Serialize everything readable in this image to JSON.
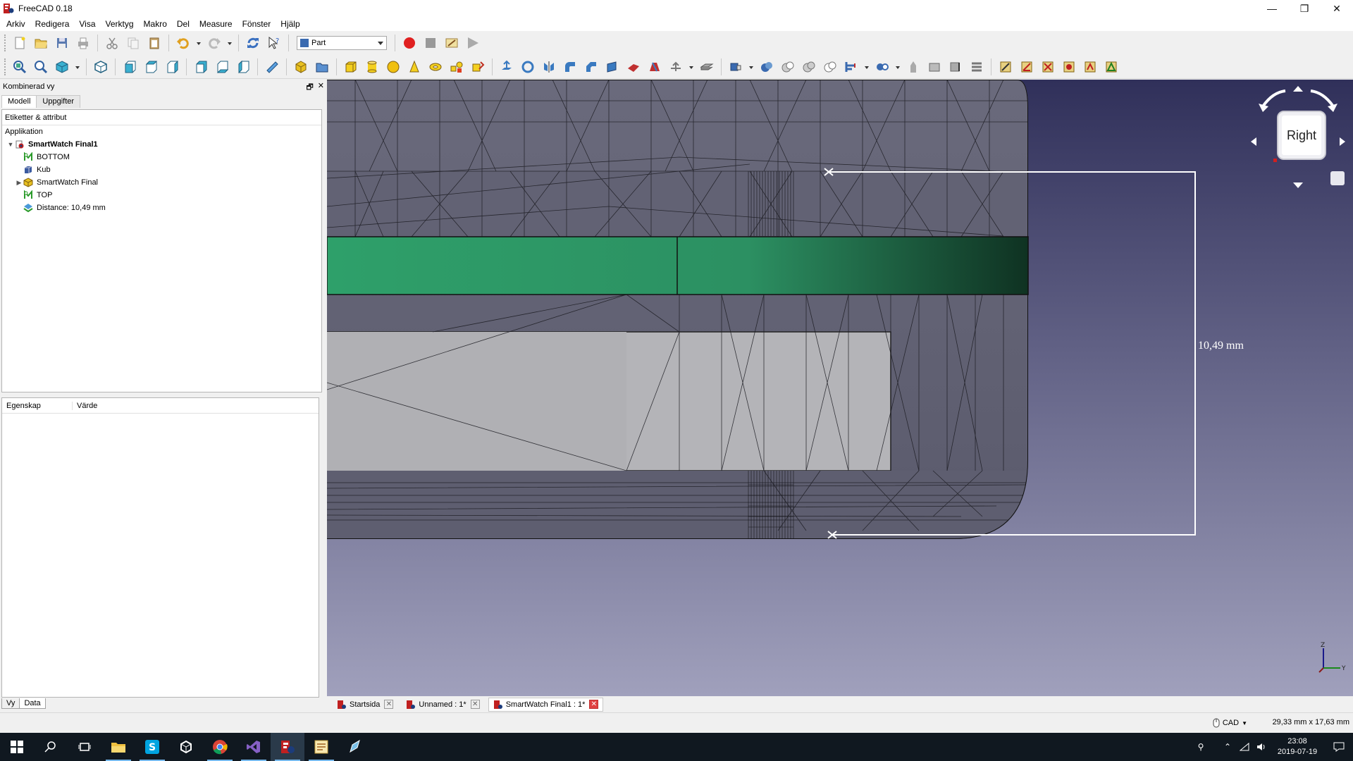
{
  "window": {
    "title": "FreeCAD 0.18",
    "controls": [
      "—",
      "❐",
      "✕"
    ]
  },
  "menu": [
    "Arkiv",
    "Redigera",
    "Visa",
    "Verktyg",
    "Makro",
    "Del",
    "Measure",
    "Fönster",
    "Hjälp"
  ],
  "toolbar": {
    "workbench": "Part"
  },
  "combo_view": {
    "title": "Kombinerad vy",
    "tabs": [
      "Modell",
      "Uppgifter"
    ],
    "tree_header": "Etiketter & attribut",
    "app_label": "Applikation",
    "document": "SmartWatch Final1",
    "items": [
      {
        "label": "BOTTOM",
        "icon": "sketch-icon",
        "expandable": false
      },
      {
        "label": "Kub",
        "icon": "cube-icon",
        "expandable": false
      },
      {
        "label": "SmartWatch Final",
        "icon": "part-compound-icon",
        "expandable": true
      },
      {
        "label": "TOP",
        "icon": "sketch-icon",
        "expandable": false
      },
      {
        "label": "Distance: 10,49 mm",
        "icon": "measure-icon",
        "expandable": false
      }
    ],
    "property_columns": [
      "Egenskap",
      "Värde"
    ],
    "view_tabs": [
      "Vy",
      "Data"
    ]
  },
  "viewport": {
    "navcube_face": "Right",
    "measurement_label": "10,49 mm",
    "axes": [
      "Z",
      "Y"
    ],
    "background_top": "#30305a",
    "background_bottom": "#a0a0bc"
  },
  "doc_tabs": [
    {
      "label": "Startsida",
      "active": false
    },
    {
      "label": "Unnamed : 1*",
      "active": false
    },
    {
      "label": "SmartWatch Final1 : 1*",
      "active": true
    }
  ],
  "status": {
    "nav_style": "CAD",
    "dimensions": "29,33 mm x 17,63 mm"
  },
  "taskbar": {
    "time": "23:08",
    "date": "2019-07-19"
  }
}
